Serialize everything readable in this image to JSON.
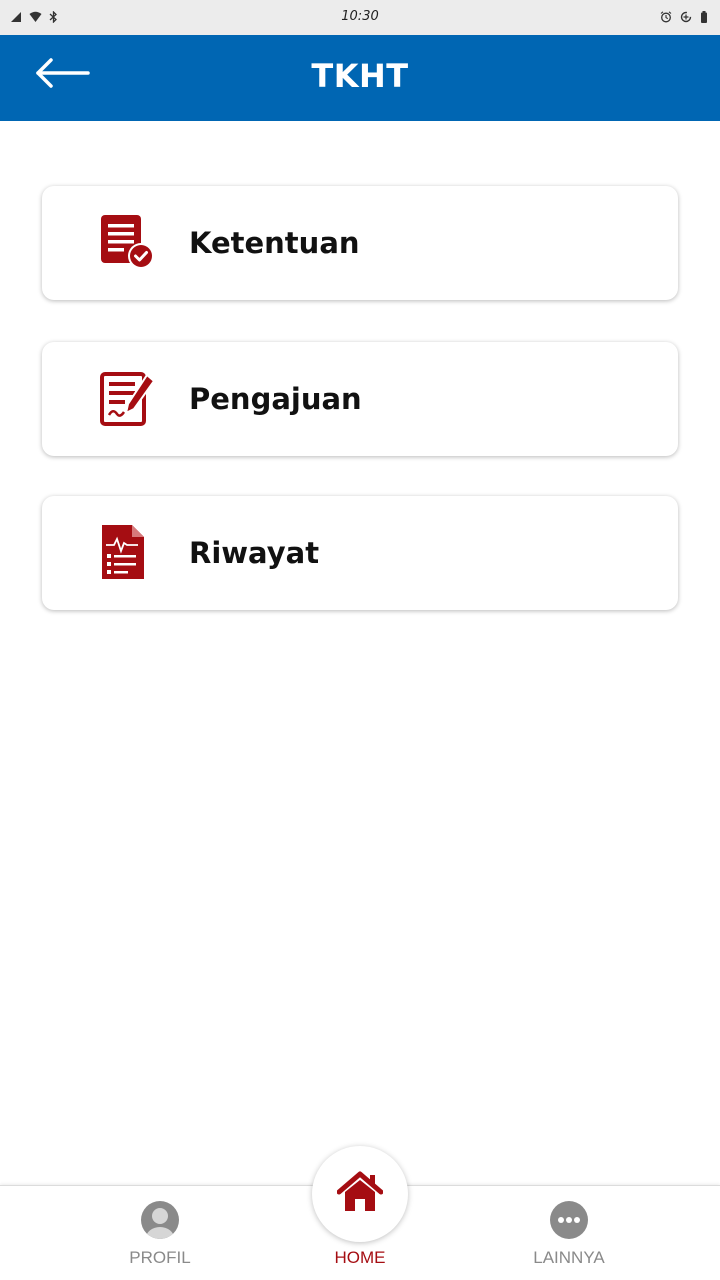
{
  "status_bar": {
    "time": "10:30",
    "icons_left": [
      "signal-icon",
      "wifi-icon",
      "bluetooth-icon"
    ],
    "icons_right": [
      "alarm-icon",
      "data-saver-icon",
      "battery-icon"
    ]
  },
  "app_bar": {
    "title": "TKHT",
    "back_icon": "arrow-left-icon",
    "color": "#0066b3"
  },
  "menu": [
    {
      "label": "Ketentuan",
      "icon": "document-check-icon"
    },
    {
      "label": "Pengajuan",
      "icon": "document-edit-icon"
    },
    {
      "label": "Riwayat",
      "icon": "document-chart-icon"
    }
  ],
  "bottom_nav": [
    {
      "label": "PROFIL",
      "icon": "user-icon",
      "active": false
    },
    {
      "label": "HOME",
      "icon": "home-icon",
      "active": true
    },
    {
      "label": "LAINNYA",
      "icon": "more-icon",
      "active": false
    }
  ],
  "colors": {
    "accent_red": "#a50d12",
    "inactive_gray": "#8a8a8a"
  }
}
